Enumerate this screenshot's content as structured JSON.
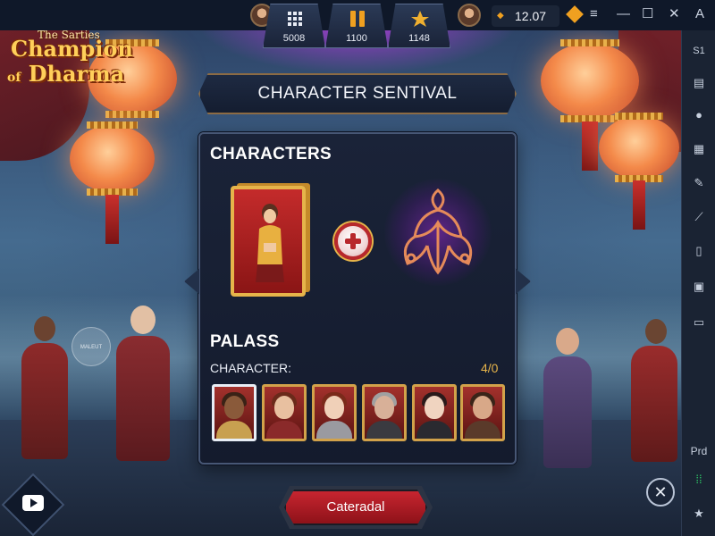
{
  "game": {
    "logo_small": "The Sarties",
    "logo_line1": "Champion",
    "logo_of": "of",
    "logo_line2": "Dharma"
  },
  "hud": {
    "items": [
      {
        "icon": "grid-icon",
        "value": "5008"
      },
      {
        "icon": "pause-icon",
        "value": "1100"
      },
      {
        "icon": "star-icon",
        "value": "1148"
      }
    ],
    "time": "12.07"
  },
  "window_controls": {
    "menu": "≡",
    "minimize": "—",
    "maximize": "☐",
    "close": "✕"
  },
  "sidebar": {
    "top_label": "A",
    "label_s": "S1",
    "prd_label": "Prd"
  },
  "title_banner": "CHARACTER SENTIVAL",
  "panel": {
    "characters_heading": "CHARACTERS",
    "palass_heading": "PALASS",
    "character_label": "CHARACTER:",
    "character_count": "4/0"
  },
  "bottom_button": "Cateradal",
  "watermark_text": "MALEUT",
  "colors": {
    "accent_gold": "#e6b44a",
    "button_red": "#c72530",
    "panel_bg": "#1a2338",
    "emblem_purple": "#9a2ad0"
  }
}
